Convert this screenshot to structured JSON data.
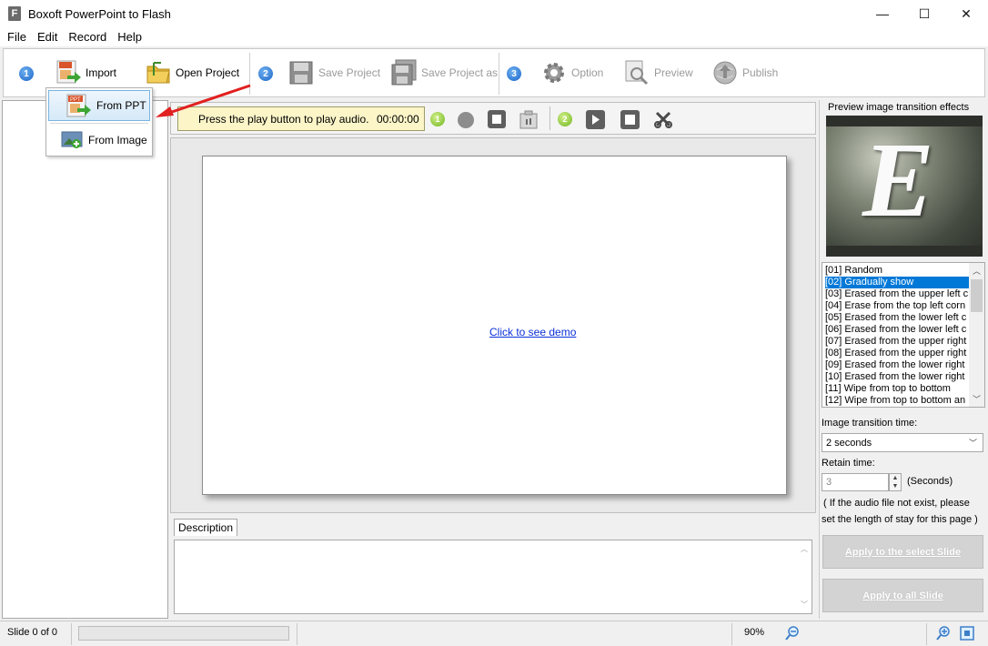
{
  "window": {
    "title": "Boxoft PowerPoint to Flash",
    "icon_letter": "F",
    "minimize": "—",
    "maximize": "☐",
    "close": "✕"
  },
  "menu": [
    "File",
    "Edit",
    "Record",
    "Help"
  ],
  "toolbar": {
    "step1": "1",
    "import": "Import",
    "open_project": "Open Project",
    "step2": "2",
    "save_project": "Save Project",
    "save_project_as": "Save Project as",
    "step3": "3",
    "option": "Option",
    "preview": "Preview",
    "publish": "Publish"
  },
  "import_menu": {
    "from_ppt": "From PPT",
    "from_image": "From Image",
    "ppt_tag": "PPT"
  },
  "player": {
    "message": "Press the play button to play audio.",
    "time": "00:00:00",
    "rec_step": "1",
    "play_step": "2"
  },
  "slide": {
    "link": "Click to see demo"
  },
  "description": {
    "tab": "Description"
  },
  "transitions": {
    "header": "Preview image transition effects",
    "preview_letter": "E",
    "effects": [
      "[01] Random",
      "[02] Gradually show",
      "[03] Erased from the upper left c",
      "[04] Erase from the top left corn",
      "[05] Erased from the lower left c",
      "[06] Erased from the lower left c",
      "[07] Erased from the upper right",
      "[08] Erased from the upper right",
      "[09] Erased from the lower right",
      "[10] Erased from the lower right",
      "[11] Wipe from top to bottom",
      "[12] Wipe from top to bottom an"
    ],
    "selected_index": 1,
    "transition_time_label": "Image transition time:",
    "transition_time_value": "2 seconds",
    "retain_label": "Retain time:",
    "retain_value": "3",
    "retain_unit": "(Seconds)",
    "note_line1": "( If the audio file not exist, please",
    "note_line2": "set the length of stay for this page )",
    "apply_selected": "Apply to the select Slide",
    "apply_all": "Apply to all Slide"
  },
  "status": {
    "slide": "Slide 0 of 0",
    "zoom": "90%"
  }
}
